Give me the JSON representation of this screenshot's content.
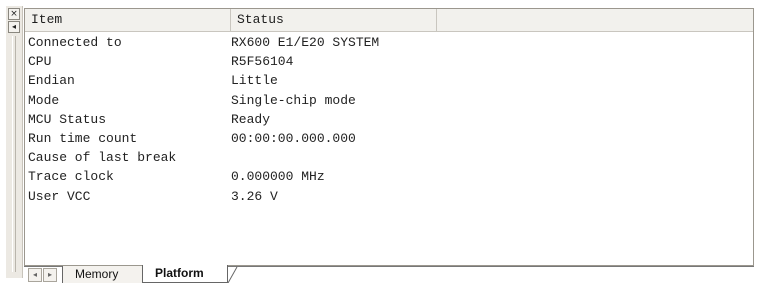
{
  "window": {
    "close_glyph": "×",
    "pin_glyph": "◂"
  },
  "list": {
    "columns": {
      "item": "Item",
      "status": "Status"
    },
    "rows": [
      {
        "item": "Connected to",
        "status": "RX600 E1/E20 SYSTEM"
      },
      {
        "item": "CPU",
        "status": "R5F56104"
      },
      {
        "item": "Endian",
        "status": "Little"
      },
      {
        "item": "Mode",
        "status": "Single-chip mode"
      },
      {
        "item": "MCU Status",
        "status": "Ready"
      },
      {
        "item": "Run time count",
        "status": "00:00:00.000.000"
      },
      {
        "item": "Cause of last break",
        "status": ""
      },
      {
        "item": "Trace clock",
        "status": "0.000000 MHz"
      },
      {
        "item": "User VCC",
        "status": "3.26 V"
      }
    ]
  },
  "tabs": {
    "nav_left": "◂",
    "nav_right": "▸",
    "items": [
      {
        "label": "Memory",
        "active": false
      },
      {
        "label": "Platform",
        "active": true
      }
    ]
  },
  "icons": [
    "close-icon",
    "pin-icon",
    "scroll-left-icon",
    "scroll-right-icon"
  ],
  "colors": {
    "panel_border": "#9b978e",
    "header_bg": "#f2f1ed",
    "grip_bg": "#ece9e3"
  }
}
